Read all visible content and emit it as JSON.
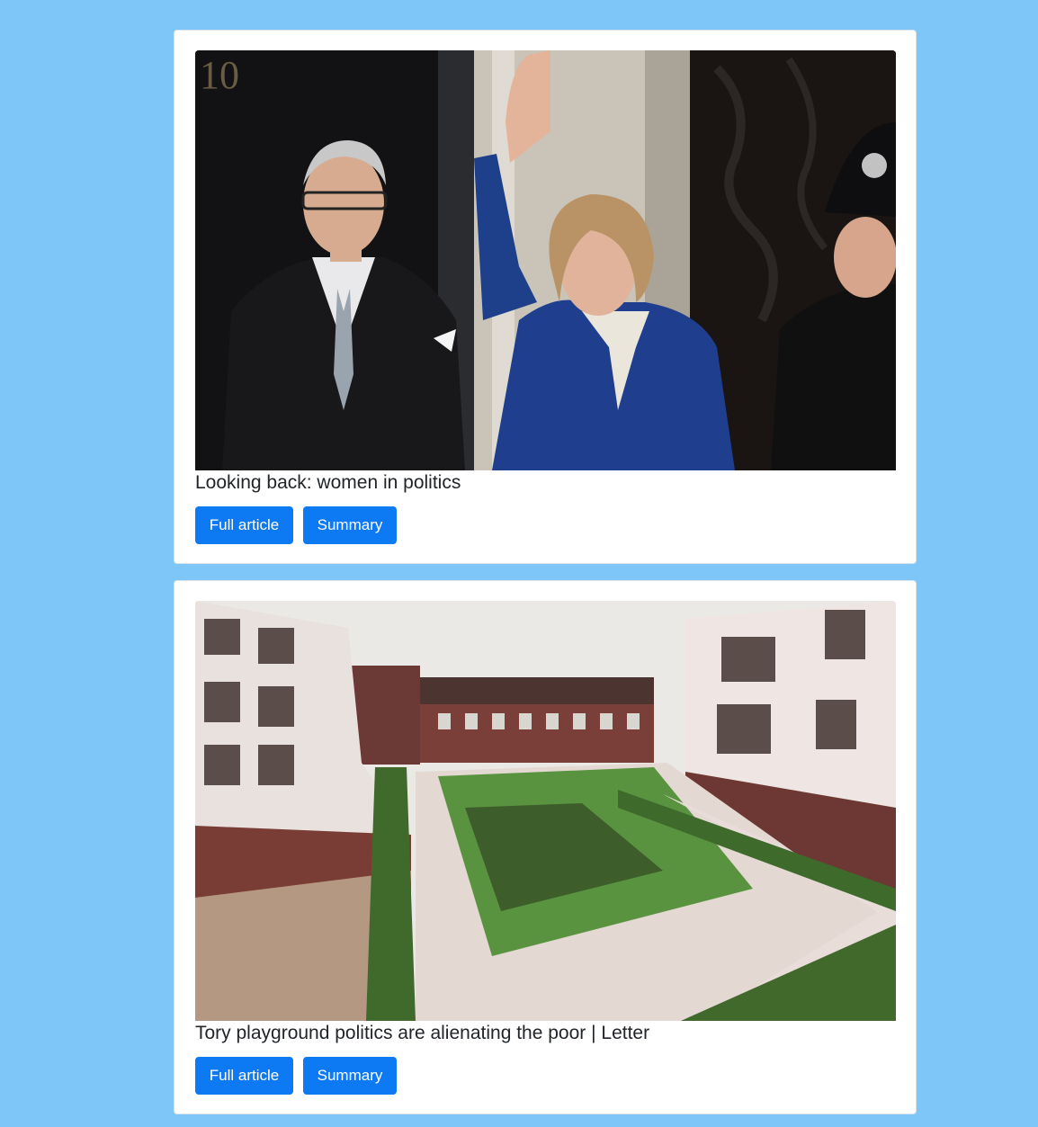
{
  "articles": [
    {
      "title": "Looking back: women in politics",
      "full_label": "Full article",
      "summary_label": "Summary"
    },
    {
      "title": "Tory playground politics are alienating the poor | Letter",
      "full_label": "Full article",
      "summary_label": "Summary"
    }
  ],
  "colors": {
    "page_background": "#7dc6f7",
    "card_background": "#ffffff",
    "button": "#0d79f2",
    "title_text": "#212529"
  }
}
